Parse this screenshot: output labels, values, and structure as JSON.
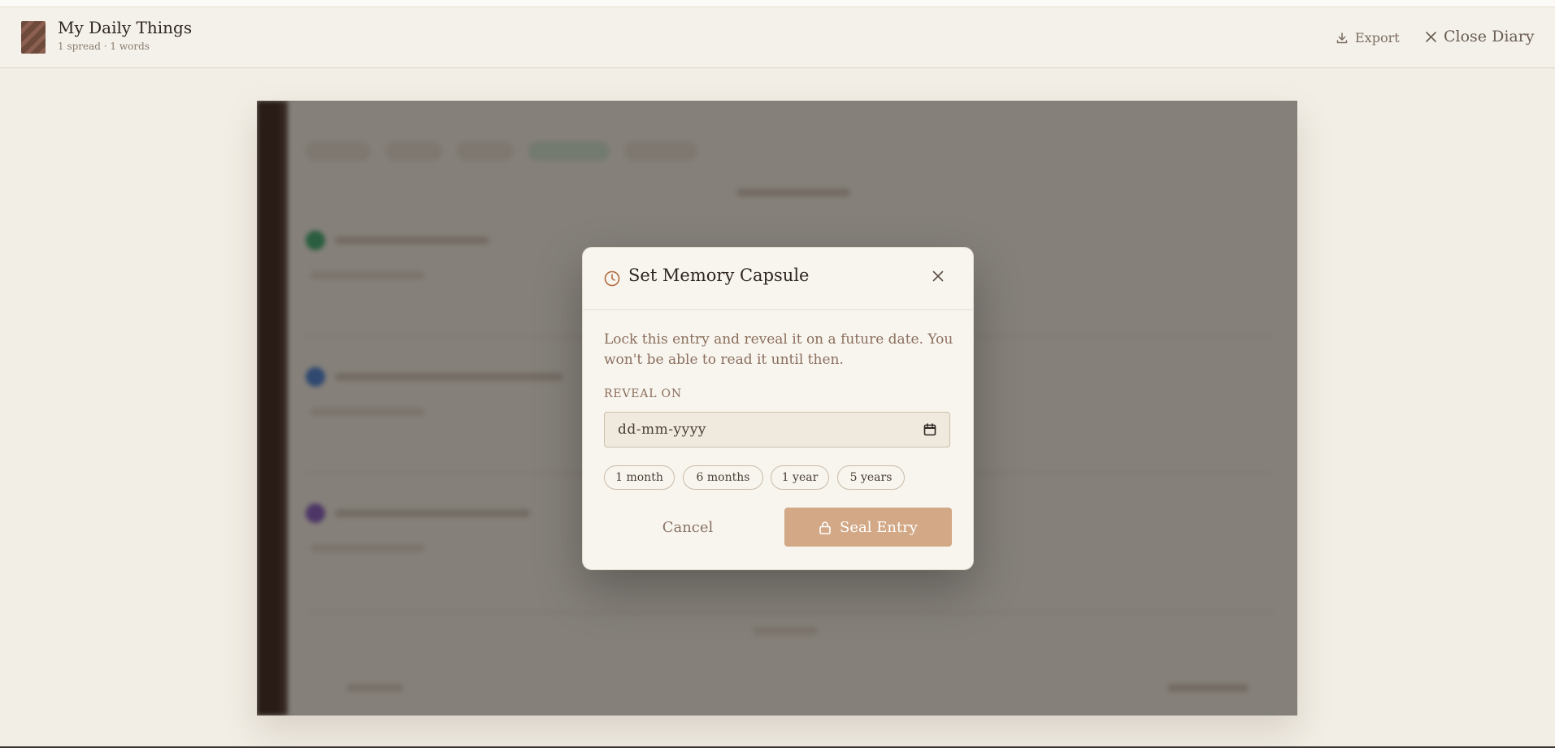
{
  "header": {
    "title": "My Daily Things",
    "subtitle": "1 spread · 1 words",
    "export_label": "Export",
    "close_label": "Close Diary"
  },
  "modal": {
    "title": "Set Memory Capsule",
    "description": "Lock this entry and reveal it on a future date. You won't be able to read it until then.",
    "reveal_label": "REVEAL ON",
    "date_placeholder": "dd-mm-yyyy",
    "presets": [
      "1 month",
      "6 months",
      "1 year",
      "5 years"
    ],
    "cancel_label": "Cancel",
    "seal_label": "Seal Entry"
  },
  "colors": {
    "accent": "#d2a886",
    "page_background": "#f2eee5",
    "icon_clock": "#b06a3c",
    "dot_green": "#2fa66a",
    "dot_blue": "#3b78d6",
    "dot_purple": "#7d4fc2"
  },
  "icons": {
    "export": "download-icon",
    "close": "close-icon",
    "modal_title": "clock-icon",
    "date": "calendar-icon",
    "seal": "lock-icon"
  }
}
